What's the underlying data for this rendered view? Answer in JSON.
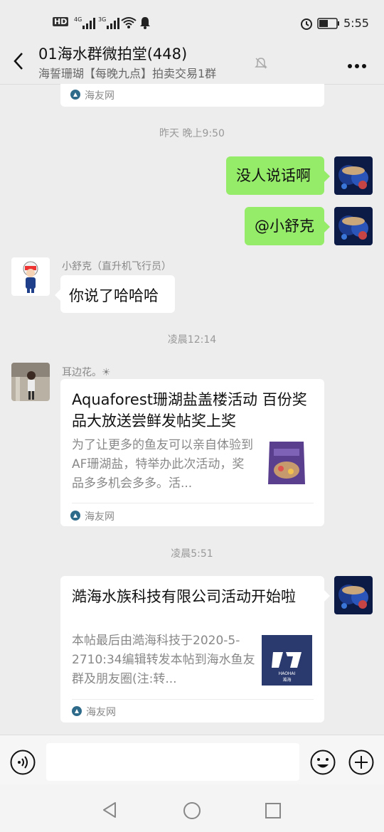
{
  "status_bar": {
    "time": "5:55",
    "hd": "HD",
    "sim1": "4G",
    "sim2": "3G"
  },
  "header": {
    "title": "01海水群微拍堂(448)",
    "subtitle": "海誓珊瑚【每晚九点】拍卖交易1群"
  },
  "messages": {
    "top_card_source": "海友网",
    "ts1": "昨天 晚上9:50",
    "msg1": "没人说话啊",
    "msg2": "@小舒克",
    "nick_shuke": "小舒克（直升机飞行员）",
    "msg3": "你说了哈哈哈",
    "ts2": "凌晨12:14",
    "nick_flower": "耳边花。☀",
    "card1": {
      "title": "Aquaforest珊湖盐盖楼活动 百份奖品大放送尝鲜发帖奖上奖",
      "desc": "为了让更多的鱼友可以亲自体验到AF珊湖盐，特举办此次活动，奖品多多机会多多。活...",
      "source": "海友网"
    },
    "ts3": "凌晨5:51",
    "card2": {
      "title": "澔海水族科技有限公司活动开始啦",
      "desc": "本帖最后由澔海科技于2020-5-2710:34编辑转发本帖到海水鱼友群及朋友圈(注:转...",
      "source": "海友网",
      "thumb_brand": "HAOHAI",
      "thumb_cn": "澔海"
    }
  },
  "colors": {
    "bubble_green": "#95ec69",
    "background": "#ededed"
  }
}
